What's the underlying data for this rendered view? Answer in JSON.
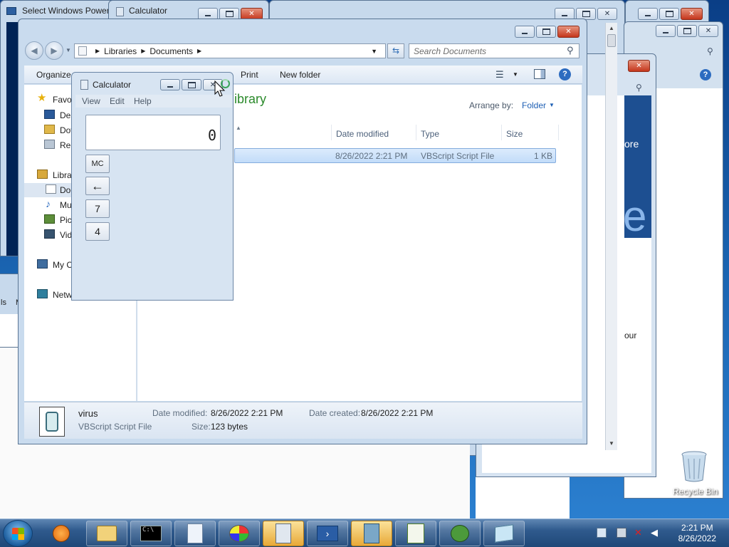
{
  "background_windows": {
    "powershell_title": "Select Windows Power",
    "calculator_back_title": "Calculator",
    "ie_partial_text_1": "ore",
    "ie_partial_text_2": "e",
    "ie_partial_text_3": "our",
    "small_left_text_1": "ls",
    "small_left_text_2": "M"
  },
  "explorer": {
    "breadcrumb": [
      "Libraries",
      "Documents"
    ],
    "search_placeholder": "Search Documents",
    "toolbar": {
      "organize": "Organize",
      "print": "Print",
      "new_folder": "New folder"
    },
    "tree": {
      "favorites": "Favo",
      "desktop": "Des",
      "downloads": "Dov",
      "recent": "Rec",
      "libraries": "Libra",
      "documents": "Doc",
      "music": "Mu",
      "pictures": "Pic",
      "videos": "Vid",
      "computer": "My C",
      "network": "Netw"
    },
    "library_heading": "ibrary",
    "arrange_by_label": "Arrange by:",
    "arrange_by_value": "Folder",
    "columns": {
      "date_modified": "Date modified",
      "type": "Type",
      "size": "Size"
    },
    "file": {
      "date_modified": "8/26/2022 2:21 PM",
      "type": "VBScript Script File",
      "size": "1 KB"
    },
    "details": {
      "name": "virus",
      "type": "VBScript Script File",
      "date_modified_label": "Date modified:",
      "date_modified_value": "8/26/2022 2:21 PM",
      "date_created_label": "Date created:",
      "date_created_value": "8/26/2022 2:21 PM",
      "size_label": "Size:",
      "size_value": "123 bytes"
    }
  },
  "calculator": {
    "title": "Calculator",
    "menu": [
      "View",
      "Edit",
      "Help"
    ],
    "display_value": "0",
    "buttons": {
      "mc": "MC",
      "backspace": "←",
      "seven": "7",
      "four": "4"
    }
  },
  "desktop": {
    "recycle_bin_label": "Recycle Bin"
  },
  "taskbar": {
    "clock_time": "2:21 PM",
    "clock_date": "8/26/2022",
    "apps": [
      "media-player-icon",
      "file-explorer-icon",
      "command-prompt-icon",
      "notepad-icon",
      "paint-icon",
      "calculator-icon",
      "powershell-icon",
      "file-cabinet-icon",
      "script-editor-icon",
      "bug-tool-icon",
      "sticky-note-icon"
    ],
    "active_app": "calculator-icon"
  },
  "colors": {
    "accent": "#1c5c9c",
    "close_button": "#c5361c",
    "selected_row": "#c2dcf9",
    "link_blue": "#1e5fb4",
    "library_green": "#2b8a2b"
  }
}
